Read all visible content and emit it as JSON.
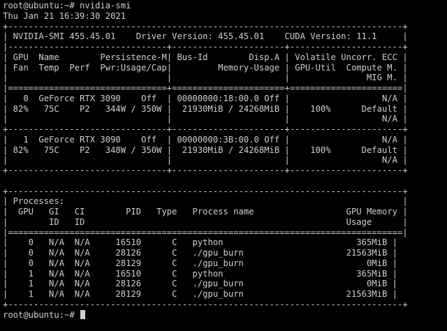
{
  "terminal": {
    "prompt": "root@ubuntu:~# ",
    "command": "nvidia-smi",
    "lines": [
      "root@ubuntu:~# nvidia-smi",
      "Thu Jan 21 16:39:30 2021",
      "+-----------------------------------------------------------------------------+",
      "| NVIDIA-SMI 455.45.01    Driver Version: 455.45.01    CUDA Version: 11.1     |",
      "|-------------------------------+----------------------+----------------------+",
      "| GPU  Name        Persistence-M| Bus-Id        Disp.A | Volatile Uncorr. ECC |",
      "| Fan  Temp  Perf  Pwr:Usage/Cap|         Memory-Usage | GPU-Util  Compute M. |",
      "|                               |                      |               MIG M. |",
      "|===============================+======================+======================|",
      "|   0  GeForce RTX 3090    Off  | 00000000:18:00.0 Off |                  N/A |",
      "| 82%   75C    P2   344W / 350W |  21930MiB / 24268MiB |    100%      Default |",
      "|                               |                      |                  N/A |",
      "+-------------------------------+----------------------+----------------------+",
      "|   1  GeForce RTX 3090    Off  | 00000000:3B:00.0 Off |                  N/A |",
      "| 82%   75C    P2   348W / 350W |  21930MiB / 24268MiB |    100%      Default |",
      "|                               |                      |                  N/A |",
      "+-------------------------------+----------------------+----------------------+",
      "",
      "+-----------------------------------------------------------------------------+",
      "| Processes:                                                                  |",
      "|  GPU   GI   CI        PID   Type   Process name                  GPU Memory |",
      "|        ID   ID                                                   Usage      |",
      "|=============================================================================|",
      "|    0   N/A  N/A     16510      C   python                          365MiB |",
      "|    0   N/A  N/A     28126      C   ./gpu_burn                    21563MiB |",
      "|    0   N/A  N/A     28129      C   ./gpu_burn                        0MiB |",
      "|    1   N/A  N/A     16510      C   python                          365MiB |",
      "|    1   N/A  N/A     28126      C   ./gpu_burn                        0MiB |",
      "|    1   N/A  N/A     28129      C   ./gpu_burn                    21563MiB |",
      "+-----------------------------------------------------------------------------+"
    ],
    "final_prompt": "root@ubuntu:~# ",
    "colors": {
      "background": "#000000",
      "foreground": "#d0d0d0",
      "cursor": "#d0d0d0"
    }
  }
}
